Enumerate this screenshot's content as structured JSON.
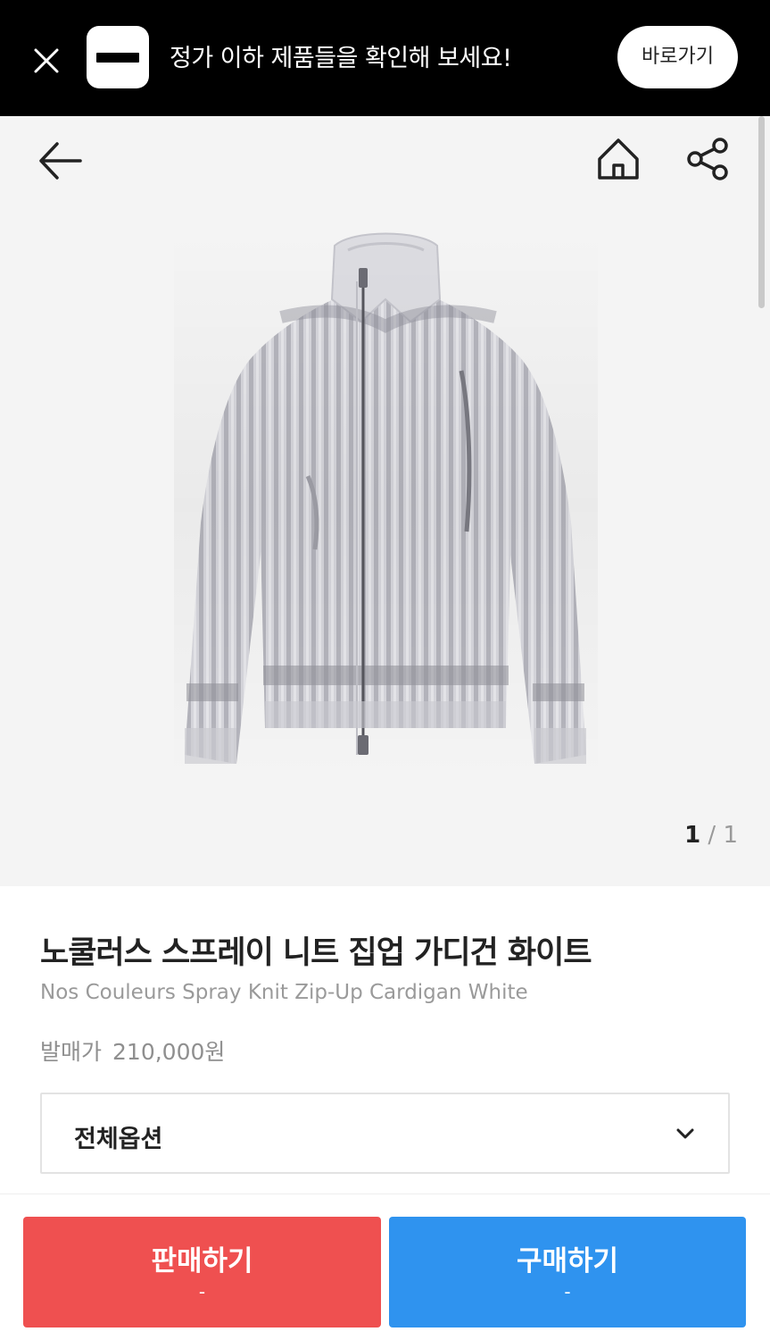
{
  "banner": {
    "message": "정가 이하 제품들을 확인해 보세요!",
    "cta_label": "바로가기",
    "close_icon": "close-icon"
  },
  "gallery": {
    "current_page": "1",
    "separator": "/",
    "total_pages": "1",
    "icons": [
      "back-arrow-icon",
      "home-icon",
      "share-icon"
    ]
  },
  "product": {
    "name_ko": "노쿨러스 스프레이 니트 집업 가디건 화이트",
    "name_en": "Nos Couleurs Spray Knit Zip-Up Cardigan White",
    "price_label": "발매가",
    "price_value": "210,000원"
  },
  "options": {
    "selected": "전체옵션",
    "icon": "chevron-down-icon"
  },
  "actions": {
    "sell_label": "판매하기",
    "sell_price": "-",
    "buy_label": "구매하기",
    "buy_price": "-"
  },
  "colors": {
    "banner_bg": "#000000",
    "gallery_bg": "#f4f4f4",
    "sell": "#ef5050",
    "buy": "#2f93ef"
  }
}
